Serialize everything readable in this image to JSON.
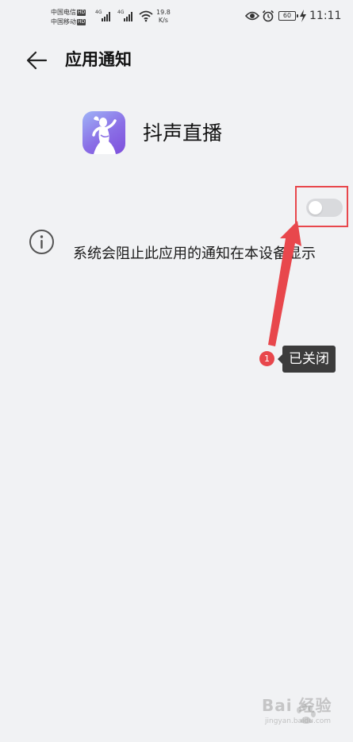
{
  "status_bar": {
    "carrier_1": "中国电信",
    "carrier_2": "中国移动",
    "hd": "HD",
    "network_gen": "4G",
    "net_speed_value": "19.8",
    "net_speed_unit": "K/s",
    "battery": "60",
    "time": "11:11"
  },
  "header": {
    "title": "应用通知"
  },
  "app": {
    "name": "抖声直播",
    "icon": "app-logo-dancer"
  },
  "notifications": {
    "enabled": false,
    "notice": "系统会阻止此应用的通知在本设备显示"
  },
  "annotation": {
    "step_number": "1",
    "callout": "已关闭",
    "color": "#e8474c"
  },
  "watermark": {
    "text": "Bai 经验",
    "url": "jingyan.baidu.com"
  },
  "colors": {
    "background": "#f1f2f4",
    "toggle_off": "#d9dadd",
    "highlight": "#e8474c"
  }
}
